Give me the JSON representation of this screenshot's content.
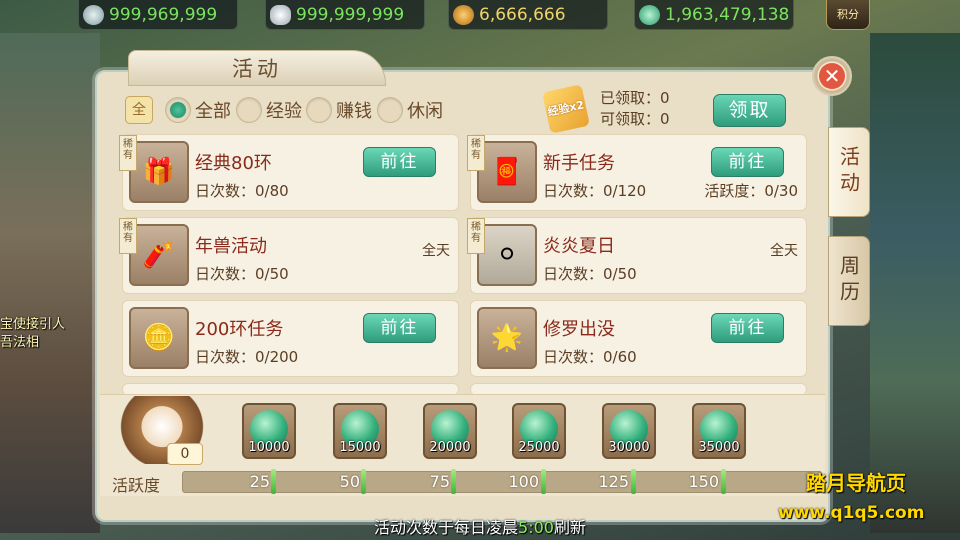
{
  "currency": {
    "silver_a": "999,969,999",
    "silver_b": "999,999,999",
    "copper": "6,666,666",
    "jade": "1,963,479,138",
    "points_label": "积分"
  },
  "scene": {
    "npc_line1": "宝使接引人",
    "npc_line2": "吾法相"
  },
  "panel": {
    "title": "活动",
    "close": "✕"
  },
  "filters": {
    "icon": "全",
    "options": [
      "全部",
      "经验",
      "赚钱",
      "休闲"
    ],
    "selected": "全部"
  },
  "claim": {
    "gift_label": "经验x2",
    "claimed_label": "已领取：0",
    "claimable_label": "可领取：0",
    "button": "领取"
  },
  "side_tabs": {
    "active": "活动",
    "other": "周历"
  },
  "cards": [
    {
      "rare": "稀有",
      "icon": "🎁",
      "name": "经典80环",
      "count": "日次数：0/80",
      "action": "前往"
    },
    {
      "rare": "稀有",
      "icon": "🧧",
      "name": "新手任务",
      "count": "日次数：0/120",
      "extra": "活跃度：0/30",
      "action": "前往"
    },
    {
      "rare": "稀有",
      "icon": "🧨",
      "name": "年兽活动",
      "count": "日次数：0/50",
      "time": "全天"
    },
    {
      "rare": "稀有",
      "icon": "⚪",
      "name": "炎炎夏日",
      "count": "日次数：0/50",
      "time": "全天"
    },
    {
      "icon": "🪙",
      "name": "200环任务",
      "count": "日次数：0/200",
      "action": "前往"
    },
    {
      "icon": "🌟",
      "name": "修罗出没",
      "count": "日次数：0/60",
      "action": "前往"
    }
  ],
  "mascot_count": "0",
  "rewards": [
    "10000",
    "15000",
    "20000",
    "25000",
    "30000",
    "35000"
  ],
  "activity": {
    "label": "活跃度",
    "current": 0,
    "max": 150,
    "ticks": [
      "25",
      "50",
      "75",
      "100",
      "125",
      "150"
    ]
  },
  "refresh_note": {
    "before": "活动次数于每日凌晨",
    "time": "5:00",
    "after": "刷新"
  },
  "watermark": {
    "line1": "踏月导航页",
    "line2": "www.q1q5.com"
  }
}
